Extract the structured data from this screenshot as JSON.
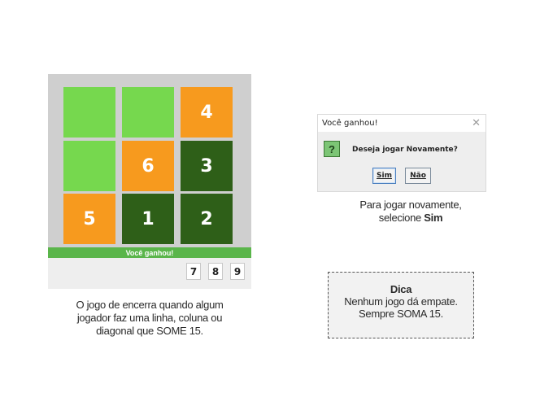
{
  "game": {
    "cells": [
      {
        "label": "",
        "color": "#76d84e"
      },
      {
        "label": "",
        "color": "#76d84e"
      },
      {
        "label": "4",
        "color": "#f79a1e"
      },
      {
        "label": "",
        "color": "#76d84e"
      },
      {
        "label": "6",
        "color": "#f79a1e"
      },
      {
        "label": "3",
        "color": "#2e5f18"
      },
      {
        "label": "5",
        "color": "#f79a1e"
      },
      {
        "label": "1",
        "color": "#2e5f18"
      },
      {
        "label": "2",
        "color": "#2e5f18"
      }
    ],
    "banner": "Você ganhou!",
    "remaining_numbers": [
      "7",
      "8",
      "9"
    ]
  },
  "caption_left": [
    "O jogo de encerra quando algum",
    "jogador faz uma linha, coluna ou",
    "diagonal que SOME 15."
  ],
  "dialog": {
    "title": "Você ganhou!",
    "close_icon": "close-icon",
    "question_icon": "?",
    "message": "Deseja jogar Novamente?",
    "yes_label": "Sim",
    "no_label": "Não"
  },
  "caption_right": {
    "line1": "Para jogar novamente,",
    "line2_prefix": "selecione ",
    "line2_bold": "Sim"
  },
  "tip": {
    "title": "Dica",
    "line1": "Nenhum jogo dá empate.",
    "line2": "Sempre SOMA 15."
  },
  "colors": {
    "light_green": "#76d84e",
    "orange": "#f79a1e",
    "dark_green": "#2e5f18",
    "banner_green": "#5ab54a"
  }
}
